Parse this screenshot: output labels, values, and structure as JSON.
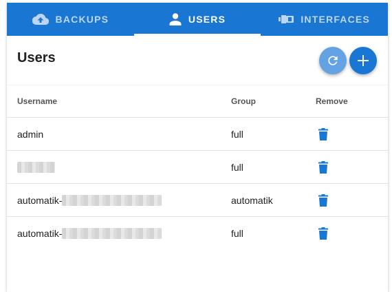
{
  "tabs": [
    {
      "label": "BACKUPS",
      "icon": "cloud-upload-icon",
      "active": false
    },
    {
      "label": "USERS",
      "icon": "user-icon",
      "active": true
    },
    {
      "label": "INTERFACES",
      "icon": "ethernet-icon",
      "active": false
    }
  ],
  "page": {
    "title": "Users"
  },
  "actions": {
    "refresh_icon": "refresh-icon",
    "add_icon": "plus-icon"
  },
  "table": {
    "headers": {
      "username": "Username",
      "group": "Group",
      "remove": "Remove"
    },
    "rows": [
      {
        "username": "admin",
        "redacted": false,
        "group": "full"
      },
      {
        "username": "",
        "redacted": true,
        "group": "full"
      },
      {
        "username": "automatik-",
        "redacted": true,
        "group": "automatik"
      },
      {
        "username": "automatik-",
        "redacted": true,
        "group": "full"
      }
    ]
  },
  "colors": {
    "primary": "#1976d2",
    "refresh_fab": "#64a2e4",
    "trash": "#1976d2"
  }
}
